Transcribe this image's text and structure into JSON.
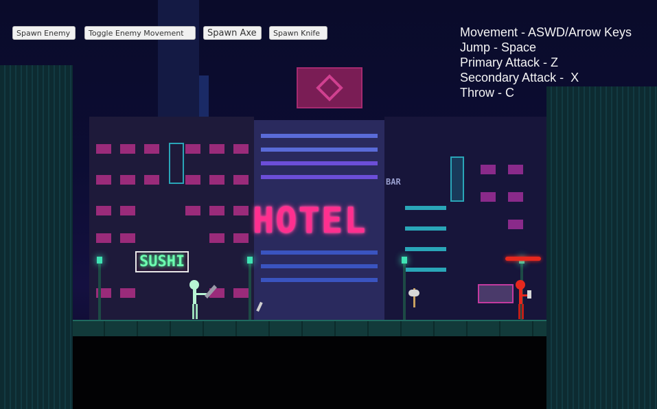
{
  "buttons": {
    "spawn_enemy": "Spawn Enemy",
    "toggle_enemy_movement": "Toggle Enemy Movement",
    "spawn_axe": "Spawn Axe",
    "spawn_knife": "Spawn Knife"
  },
  "controls": {
    "movement": "Movement - ASWD/Arrow Keys",
    "jump": "Jump - Space",
    "primary": "Primary Attack - Z",
    "secondary": "Secondary Attack -  X",
    "throw": "Throw - C"
  },
  "signs": {
    "hotel": "HOTEL",
    "sushi": "SUSHI",
    "bar": "BAR"
  },
  "colors": {
    "player": "#b8f5d4",
    "enemy": "#e5281e",
    "neon_pink": "#ff2f8f",
    "neon_green": "#44ff9a",
    "lamp": "#3fe3b4"
  }
}
